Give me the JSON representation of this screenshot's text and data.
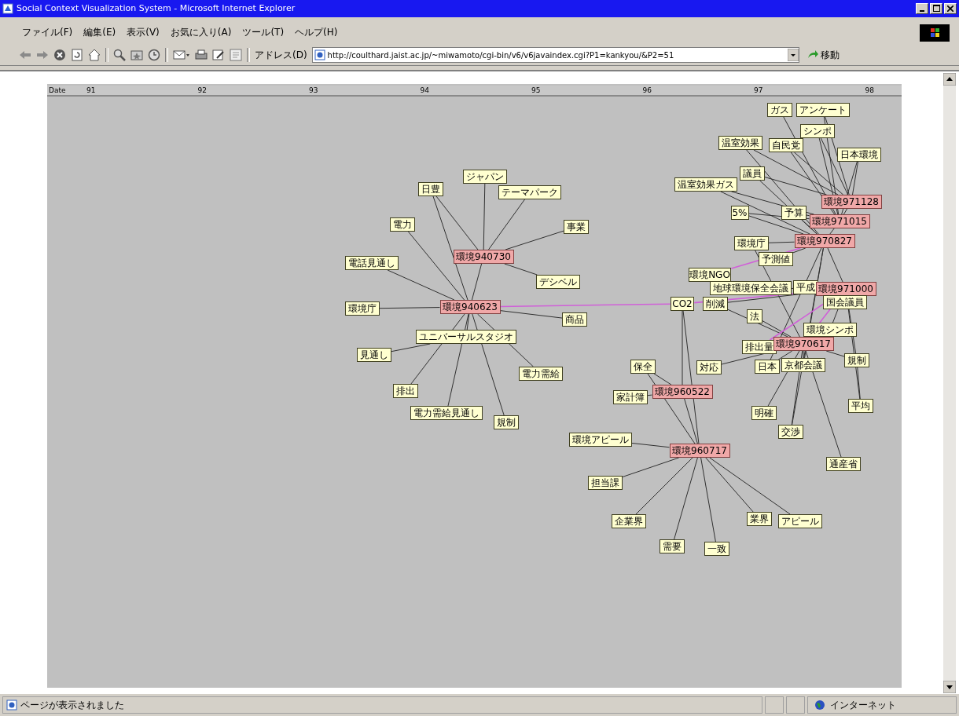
{
  "window": {
    "title": "Social Context Visualization System - Microsoft Internet Explorer"
  },
  "menu": [
    "ファイル(F)",
    "編集(E)",
    "表示(V)",
    "お気に入り(A)",
    "ツール(T)",
    "ヘルプ(H)"
  ],
  "address": {
    "label": "アドレス(D)",
    "value": "http://coulthard.jaist.ac.jp/~miwamoto/cgi-bin/v6/v6javaindex.cgi?P1=kankyou/&P2=51",
    "go": "移動"
  },
  "timeline": {
    "label": "Date",
    "ticks": [
      "91",
      "92",
      "93",
      "94",
      "95",
      "96",
      "97",
      "98"
    ]
  },
  "nodes": [
    {
      "label": "ジャパン",
      "kind": "keyword"
    },
    {
      "label": "日豊",
      "kind": "keyword"
    },
    {
      "label": "テーマパーク",
      "kind": "keyword"
    },
    {
      "label": "電力",
      "kind": "keyword"
    },
    {
      "label": "事業",
      "kind": "keyword"
    },
    {
      "label": "環境940730",
      "kind": "event"
    },
    {
      "label": "電話見通し",
      "kind": "keyword"
    },
    {
      "label": "デシベル",
      "kind": "keyword"
    },
    {
      "label": "環境庁",
      "kind": "keyword"
    },
    {
      "label": "環境940623",
      "kind": "event"
    },
    {
      "label": "商品",
      "kind": "keyword"
    },
    {
      "label": "ユニバーサルスタジオ",
      "kind": "keyword"
    },
    {
      "label": "見通し",
      "kind": "keyword"
    },
    {
      "label": "電力需給",
      "kind": "keyword"
    },
    {
      "label": "排出",
      "kind": "keyword"
    },
    {
      "label": "電力需給見通し",
      "kind": "keyword"
    },
    {
      "label": "規制",
      "kind": "keyword"
    },
    {
      "label": "ガス",
      "kind": "keyword"
    },
    {
      "label": "アンケート",
      "kind": "keyword"
    },
    {
      "label": "シンポ",
      "kind": "keyword"
    },
    {
      "label": "温室効果",
      "kind": "keyword"
    },
    {
      "label": "自民党",
      "kind": "keyword"
    },
    {
      "label": "日本環境",
      "kind": "keyword"
    },
    {
      "label": "議員",
      "kind": "keyword"
    },
    {
      "label": "温室効果ガス",
      "kind": "keyword"
    },
    {
      "label": "5%",
      "kind": "keyword"
    },
    {
      "label": "予算",
      "kind": "keyword"
    },
    {
      "label": "環境971128",
      "kind": "event"
    },
    {
      "label": "環境971015",
      "kind": "event"
    },
    {
      "label": "環境970827",
      "kind": "event"
    },
    {
      "label": "環境庁",
      "kind": "keyword"
    },
    {
      "label": "予測値",
      "kind": "keyword"
    },
    {
      "label": "環境NGO",
      "kind": "keyword"
    },
    {
      "label": "地球環境保全会議",
      "kind": "keyword"
    },
    {
      "label": "CO2",
      "kind": "keyword"
    },
    {
      "label": "削減",
      "kind": "keyword"
    },
    {
      "label": "平成",
      "kind": "keyword"
    },
    {
      "label": "環境971000",
      "kind": "event"
    },
    {
      "label": "国会議員",
      "kind": "keyword"
    },
    {
      "label": "法",
      "kind": "keyword"
    },
    {
      "label": "環境シンポ",
      "kind": "keyword"
    },
    {
      "label": "排出量",
      "kind": "keyword"
    },
    {
      "label": "環境970617",
      "kind": "event"
    },
    {
      "label": "対応",
      "kind": "keyword"
    },
    {
      "label": "日本",
      "kind": "keyword"
    },
    {
      "label": "京都会議",
      "kind": "keyword"
    },
    {
      "label": "規制",
      "kind": "keyword"
    },
    {
      "label": "保全",
      "kind": "keyword"
    },
    {
      "label": "環境960522",
      "kind": "event"
    },
    {
      "label": "家計簿",
      "kind": "keyword"
    },
    {
      "label": "明確",
      "kind": "keyword"
    },
    {
      "label": "平均",
      "kind": "keyword"
    },
    {
      "label": "交渉",
      "kind": "keyword"
    },
    {
      "label": "通産省",
      "kind": "keyword"
    },
    {
      "label": "環境アピール",
      "kind": "keyword"
    },
    {
      "label": "環境960717",
      "kind": "event"
    },
    {
      "label": "担当課",
      "kind": "keyword"
    },
    {
      "label": "企業界",
      "kind": "keyword"
    },
    {
      "label": "業界",
      "kind": "keyword"
    },
    {
      "label": "アピール",
      "kind": "keyword"
    },
    {
      "label": "需要",
      "kind": "keyword"
    },
    {
      "label": "一致",
      "kind": "keyword"
    }
  ],
  "status_bar": {
    "message": "ページが表示されました",
    "zone": "インターネット"
  }
}
